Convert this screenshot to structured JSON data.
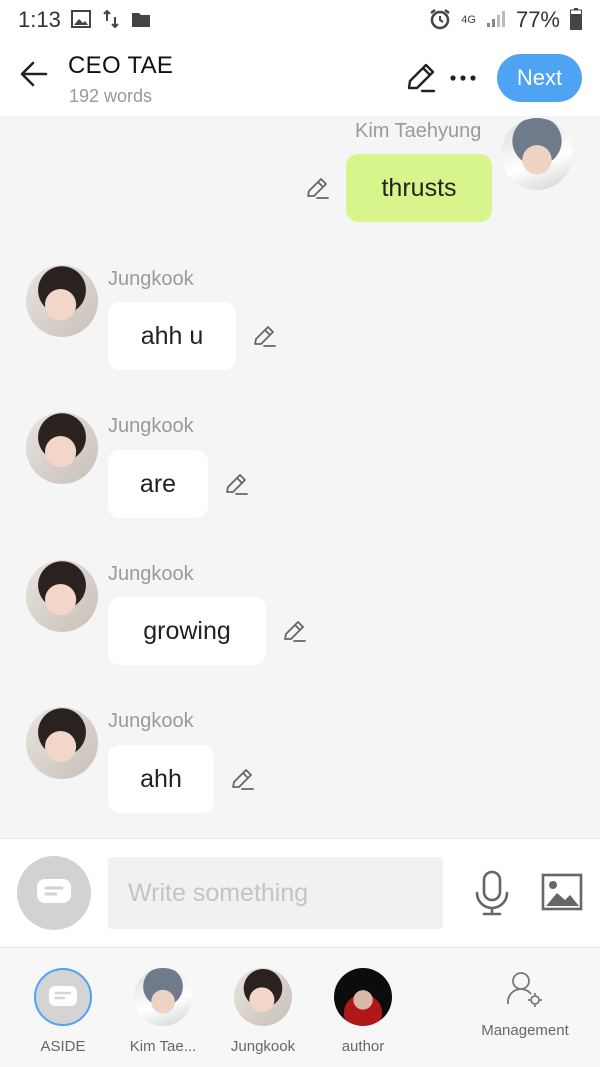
{
  "status_bar": {
    "time": "1:13",
    "network": "4G",
    "battery": "77%"
  },
  "header": {
    "title": "CEO TAE",
    "word_count": "192 words",
    "next_label": "Next"
  },
  "messages": [
    {
      "sender": "Kim Taehyung",
      "text": "thrusts",
      "side": "right"
    },
    {
      "sender": "Jungkook",
      "text": "ahh u",
      "side": "left"
    },
    {
      "sender": "Jungkook",
      "text": "are",
      "side": "left"
    },
    {
      "sender": "Jungkook",
      "text": "growing",
      "side": "left"
    },
    {
      "sender": "Jungkook",
      "text": "ahh",
      "side": "left"
    }
  ],
  "composer": {
    "placeholder": "Write something"
  },
  "bottom_bar": {
    "characters": [
      {
        "label": "ASIDE",
        "selected": true
      },
      {
        "label": "Kim Tae..."
      },
      {
        "label": "Jungkook"
      },
      {
        "label": "author"
      }
    ],
    "management_label": "Management"
  },
  "colors": {
    "accent": "#4ea3f2",
    "self_bubble": "#d8f58b",
    "other_bubble": "#ffffff",
    "background": "#f5f5f5"
  }
}
